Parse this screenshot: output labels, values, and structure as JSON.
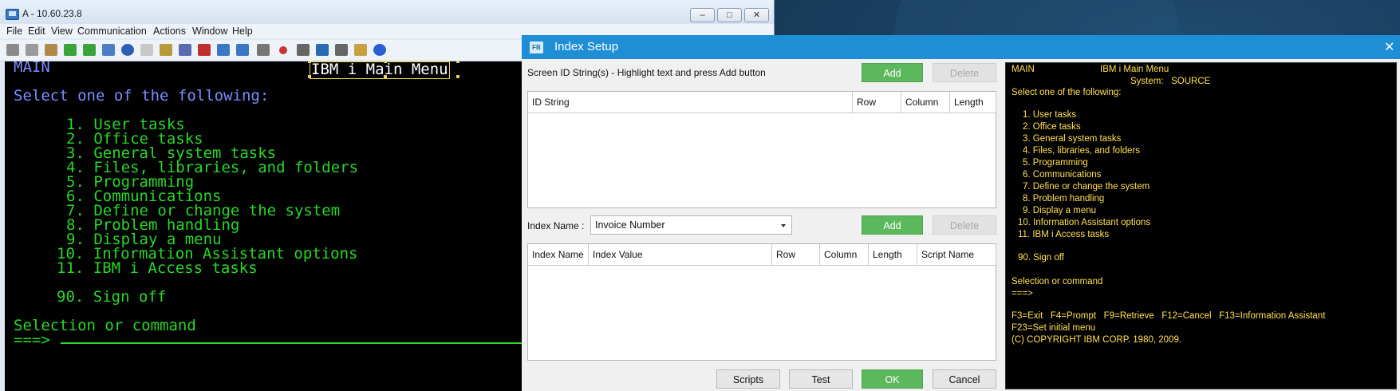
{
  "emulator": {
    "title": "A - 10.60.23.8",
    "window_buttons": [
      "–",
      "□",
      "✕"
    ],
    "menu": [
      "File",
      "Edit",
      "View",
      "Communication",
      "Actions",
      "Window",
      "Help"
    ],
    "toolbar_icons": [
      "copy-icon",
      "copy-append-icon",
      "paste-icon",
      "send-file-icon",
      "receive-file-icon",
      "print-icon",
      "navigate-icon",
      "notes-icon",
      "macro-icon",
      "keypad-icon",
      "settings-icon",
      "display-icon",
      "keyboard-icon",
      "calendar-icon",
      "edit-icon",
      "record-icon",
      "play-icon",
      "stop-icon",
      "pause-icon",
      "script-icon",
      "help-icon"
    ],
    "screen": {
      "main_label": "MAIN",
      "header_title": "IBM i Main Menu",
      "prompt": "Select one of the following:",
      "options": [
        "1. User tasks",
        "2. Office tasks",
        "3. General system tasks",
        "4. Files, libraries, and folders",
        "5. Programming",
        "6. Communications",
        "7. Define or change the system",
        "8. Problem handling",
        "9. Display a menu",
        "10. Information Assistant options",
        "11. IBM i Access tasks"
      ],
      "signoff": "90. Sign off",
      "selection": "Selection or command",
      "cursor": "===>"
    }
  },
  "dialog": {
    "title": "Index Setup",
    "logo": "FB",
    "close": "✕",
    "screen_id_label": "Screen ID String(s)  -  Highlight text and press Add button",
    "add_label": "Add",
    "delete_label": "Delete",
    "id_grid_columns": [
      "ID String",
      "Row",
      "Column",
      "Length"
    ],
    "index_name_label": "Index Name :",
    "index_name_value": "Invoice Number",
    "index_grid_columns": [
      "Index Name",
      "Index Value",
      "Row",
      "Column",
      "Length",
      "Script Name"
    ],
    "buttons": {
      "scripts": "Scripts",
      "test": "Test",
      "ok": "OK",
      "cancel": "Cancel"
    },
    "preview": {
      "main": "MAIN",
      "title": "IBM i Main Menu",
      "system": "System:   SOURCE",
      "prompt": "Select one of the following:",
      "options": [
        "1. User tasks",
        "2. Office tasks",
        "3. General system tasks",
        "4. Files, libraries, and folders",
        "5. Programming",
        "6. Communications",
        "7. Define or change the system",
        "8. Problem handling",
        "9. Display a menu",
        "10. Information Assistant options",
        "11. IBM i Access tasks"
      ],
      "signoff": "90. Sign off",
      "selection": "Selection or command",
      "cursor": "===>",
      "fkeys": "F3=Exit   F4=Prompt   F9=Retrieve   F12=Cancel   F13=Information Assistant",
      "fkeys2": "F23=Set initial menu",
      "copyright": "(C) COPYRIGHT IBM CORP. 1980, 2009."
    }
  }
}
